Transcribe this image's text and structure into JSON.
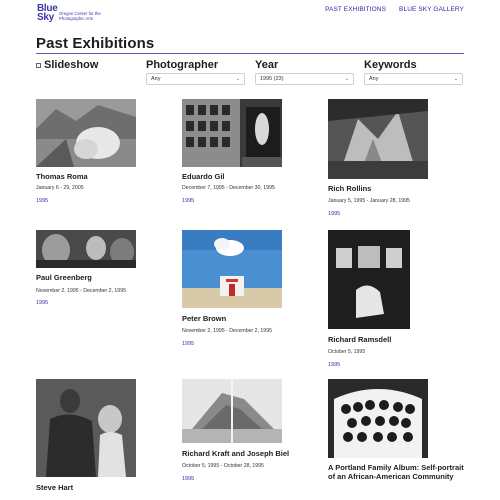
{
  "brand": {
    "logo_text": "Blue Sky",
    "logo_sub": "Oregon Center for the Photographic Arts"
  },
  "nav": {
    "past": "PAST EXHIBITIONS",
    "gallery": "BLUE SKY GALLERY"
  },
  "page_title": "Past Exhibitions",
  "filters": {
    "slideshow": "Slideshow",
    "photographer": {
      "label": "Photographer",
      "value": "Any"
    },
    "year": {
      "label": "Year",
      "value": "1995 (23)"
    },
    "keywords": {
      "label": "Keywords",
      "value": "Any"
    }
  },
  "exhibitions": [
    {
      "name": "Thomas Roma",
      "dates": "January 6 - 29, 2005",
      "year": "1995"
    },
    {
      "name": "Eduardo Gil",
      "dates": "December 7, 1995 - December 30, 1995",
      "year": "1995"
    },
    {
      "name": "Rich Rollins",
      "dates": "January 5, 1995 - January 28, 1995",
      "year": "1995"
    },
    {
      "name": "Paul Greenberg",
      "dates": "November 2, 1995 - December 2, 1995",
      "year": "1995"
    },
    {
      "name": "Peter Brown",
      "dates": "November 2, 1995 - December 2, 1995",
      "year": "1995"
    },
    {
      "name": "Richard Ramsdell",
      "dates": "October 5, 1995",
      "year": "1995"
    },
    {
      "name": "Steve Hart",
      "dates": "",
      "year": ""
    },
    {
      "name": "Richard Kraft and Joseph Biel",
      "dates": "October 5, 1995 - October 28, 1995",
      "year": "1995"
    },
    {
      "name": "A Portland Family Album: Self-portrait of an African-American Community",
      "dates": "",
      "year": ""
    }
  ],
  "colors": {
    "brand": "#3a3aa8",
    "link": "#3030b0",
    "rule": "#5a5ab5"
  }
}
